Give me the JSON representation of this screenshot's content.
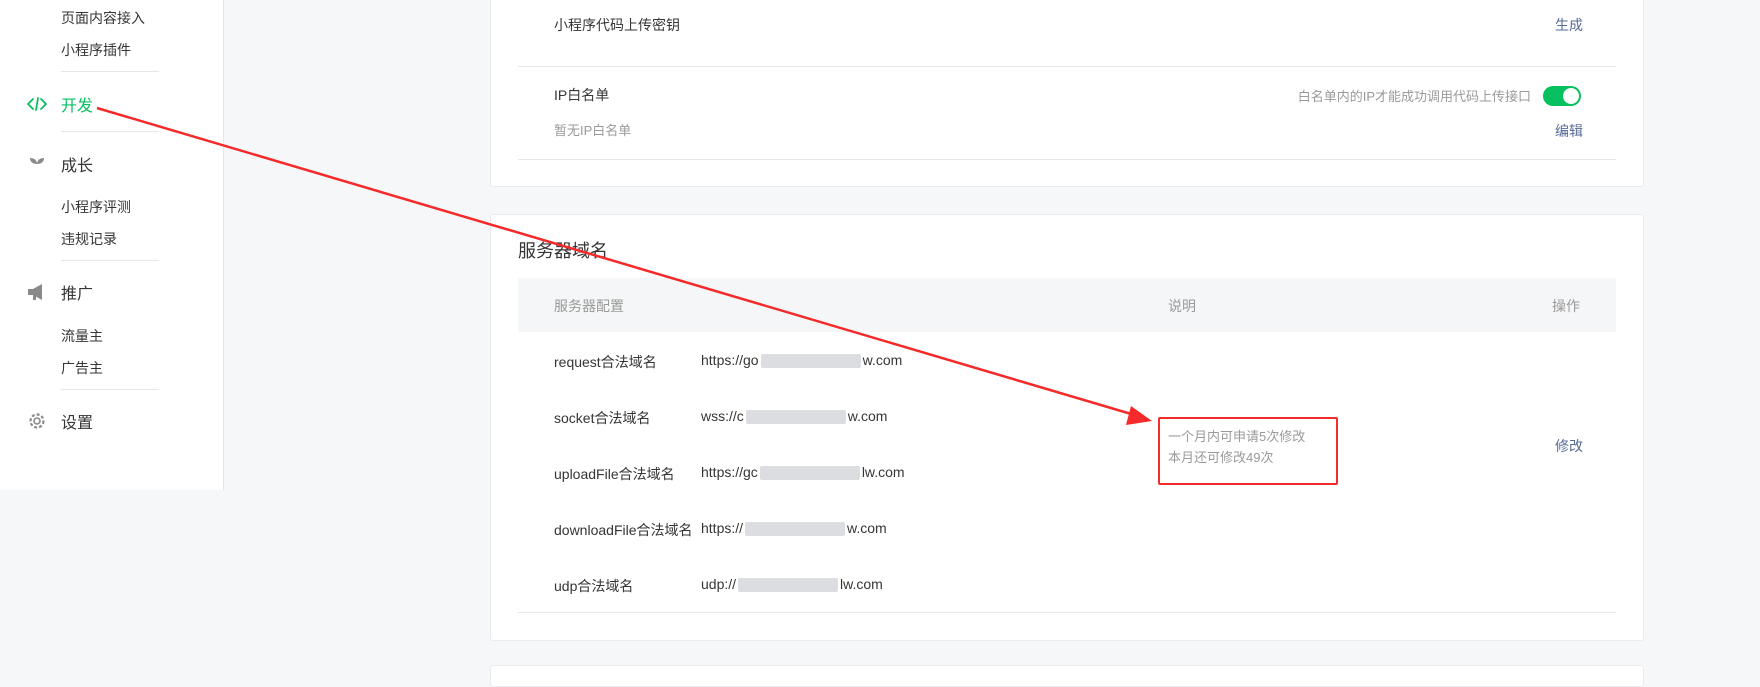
{
  "sidebar": {
    "top_items": [
      "页面内容接入",
      "小程序插件"
    ],
    "dev_label": "开发",
    "grow_label": "成长",
    "grow_items": [
      "小程序评测",
      "违规记录"
    ],
    "promo_label": "推广",
    "promo_items": [
      "流量主",
      "广告主"
    ],
    "settings_label": "设置"
  },
  "upload_key": {
    "label": "小程序代码上传密钥",
    "action": "生成"
  },
  "ip_whitelist": {
    "label": "IP白名单",
    "empty": "暂无IP白名单",
    "hint": "白名单内的IP才能成功调用代码上传接口",
    "edit": "编辑",
    "enabled": true
  },
  "server_domains": {
    "title": "服务器域名",
    "columns": [
      "服务器配置",
      "说明",
      "操作"
    ],
    "rows": [
      {
        "name": "request合法域名",
        "prefix": "https://go",
        "suffix": "w.com"
      },
      {
        "name": "socket合法域名",
        "prefix": "wss://c",
        "suffix": "w.com"
      },
      {
        "name": "uploadFile合法域名",
        "prefix": "https://gc",
        "suffix": "lw.com"
      },
      {
        "name": "downloadFile合法域名",
        "prefix": "https://",
        "suffix": "w.com"
      },
      {
        "name": "udp合法域名",
        "prefix": "udp://",
        "suffix": "lw.com"
      }
    ],
    "note_line1": "一个月内可申请5次修改",
    "note_line2": "本月还可修改49次",
    "action": "修改"
  },
  "colors": {
    "accent": "#07c160",
    "link": "#576b95",
    "annotation": "#f52a2a"
  }
}
